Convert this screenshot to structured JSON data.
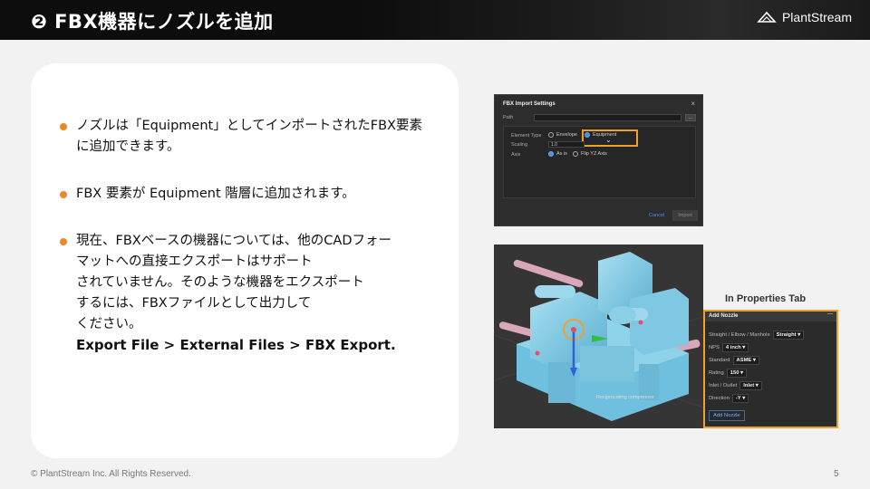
{
  "header": {
    "title": "❷ FBX機器にノズルを追加",
    "logo_text": "PlantStream"
  },
  "bullets": [
    {
      "lines": [
        "ノズルは「Equipment」としてインポートされたFBX要素",
        "に追加できます。"
      ]
    },
    {
      "lines": [
        "FBX 要素が Equipment 階層に追加されます。"
      ]
    },
    {
      "lines": [
        "現在、FBXベースの機器については、他のCADフォー",
        "マットへの直接エクスポートはサポート",
        "されていません。そのような機器をエクスポート",
        "するには、FBXファイルとして出力して",
        "ください。"
      ],
      "bold_line": "Export File > External Files > FBX Export."
    }
  ],
  "dialog": {
    "title": "FBX Import Settings",
    "close": "×",
    "path_label": "Path",
    "path_button": "...",
    "element_type_label": "Element Type",
    "option_envelope": "Envelope",
    "option_equipment": "Equipment",
    "scaling_label": "Scaling",
    "scaling_value": "1.0",
    "axis_label": "Axis",
    "option_as_is": "As is",
    "option_flip": "Flip YZ Axis",
    "cancel": "Cancel",
    "import": "Import"
  },
  "viewport": {
    "caption": "Reciprocating compressor"
  },
  "properties": {
    "tab_title": "In Properties Tab",
    "panel_title": "Add Nozzle",
    "minimize": "—",
    "rows": [
      {
        "label": "Straight / Elbow / Manhole",
        "value": "Straight"
      },
      {
        "label": "NPS",
        "value": "4 inch"
      },
      {
        "label": "Standard",
        "value": "ASME"
      },
      {
        "label": "Rating",
        "value": "150"
      },
      {
        "label": "Inlet / Outlet",
        "value": "Inlet"
      },
      {
        "label": "Direction",
        "value": "-Y"
      }
    ],
    "add_button": "Add Nozzle"
  },
  "footer": {
    "copyright": "© PlantStream Inc. All Rights Reserved.",
    "page": "5"
  },
  "colors": {
    "accent": "#e8892a",
    "highlight": "#f0a030",
    "header_bg": "#0d0d0d"
  }
}
